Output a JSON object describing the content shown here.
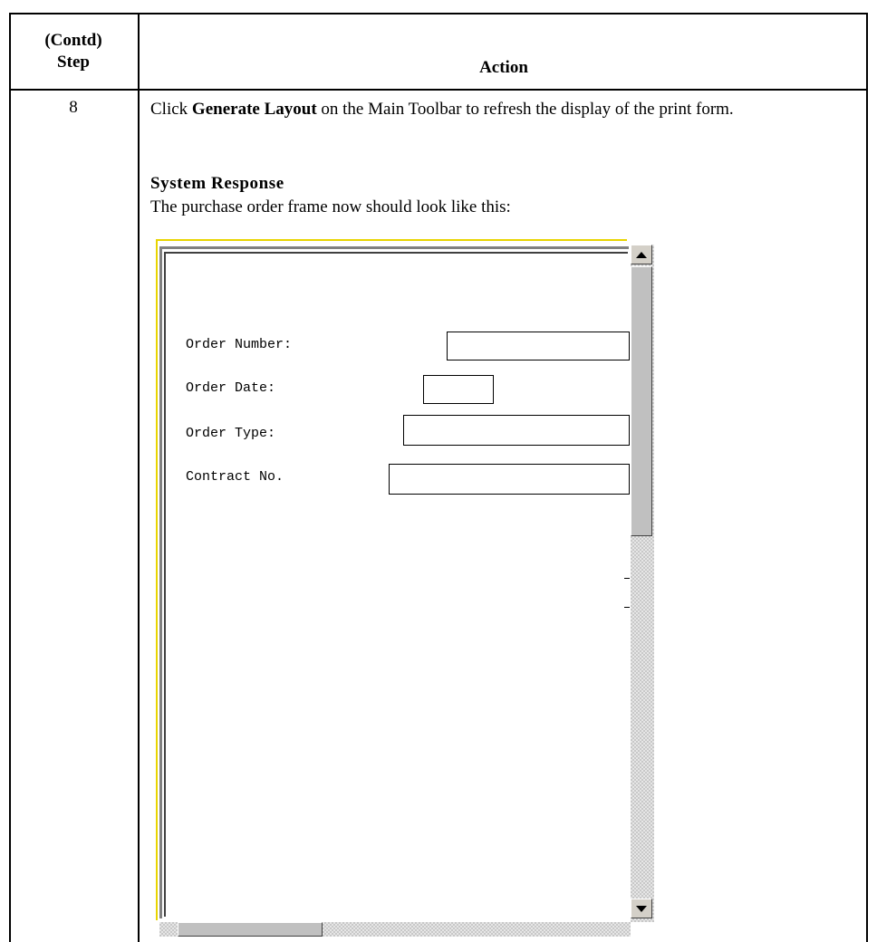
{
  "header": {
    "step_line1": "(Contd)",
    "step_line2": "Step",
    "action": "Action"
  },
  "row": {
    "step_number": "8",
    "instruction_prefix": "Click ",
    "instruction_bold": "Generate Layout",
    "instruction_suffix": " on the Main Toolbar to refresh the display of the print form.",
    "system_response_heading": "System Response",
    "system_response_text": "The purchase order frame now should look like this:"
  },
  "form": {
    "fields": [
      {
        "label": "Order Number:"
      },
      {
        "label": "Order Date:"
      },
      {
        "label": "Order Type:"
      },
      {
        "label": "Contract No."
      }
    ]
  },
  "scrollbar": {
    "up_icon": "arrow-up-icon",
    "down_icon": "arrow-down-icon"
  },
  "colors": {
    "selection_border": "#e8d400",
    "scrollbar_face": "#c0c0c0"
  }
}
